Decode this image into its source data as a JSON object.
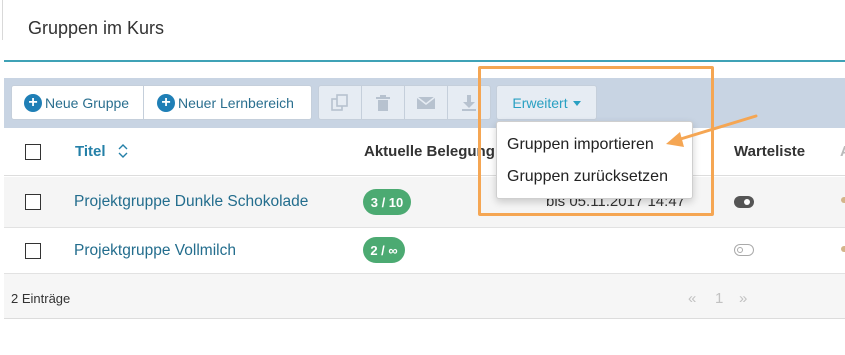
{
  "page": {
    "title": "Gruppen im Kurs"
  },
  "toolbar": {
    "new_group_label": "Neue Gruppe",
    "new_area_label": "Neuer Lernbereich",
    "advanced_label": "Erweitert",
    "icons": [
      "copy-icon",
      "trash-icon",
      "mail-icon",
      "download-icon"
    ]
  },
  "dropdown": {
    "items": [
      "Gruppen importieren",
      "Gruppen zurücksetzen"
    ]
  },
  "table": {
    "columns": {
      "title": "Titel",
      "occupancy": "Aktuelle Belegung",
      "waitlist": "Warteliste",
      "cut_off": "A"
    },
    "rows": [
      {
        "title": "Projektgruppe Dunkle Schokolade",
        "occupancy": "3 / 10",
        "deadline": "bis 05.11.2017 14:47",
        "waitlist": "on"
      },
      {
        "title": "Projektgruppe Vollmilch",
        "occupancy": "2 / ∞",
        "deadline": "",
        "waitlist": "off"
      }
    ]
  },
  "footer": {
    "entries": "2 Einträge",
    "pager_prev": "«",
    "pager_page": "1",
    "pager_next": "»"
  },
  "colors": {
    "accent": "#3fa2b6",
    "link": "#236d8d",
    "badge": "#4caa72",
    "annotation": "#f5a653",
    "toolbar_bg": "#c8d4e3"
  }
}
